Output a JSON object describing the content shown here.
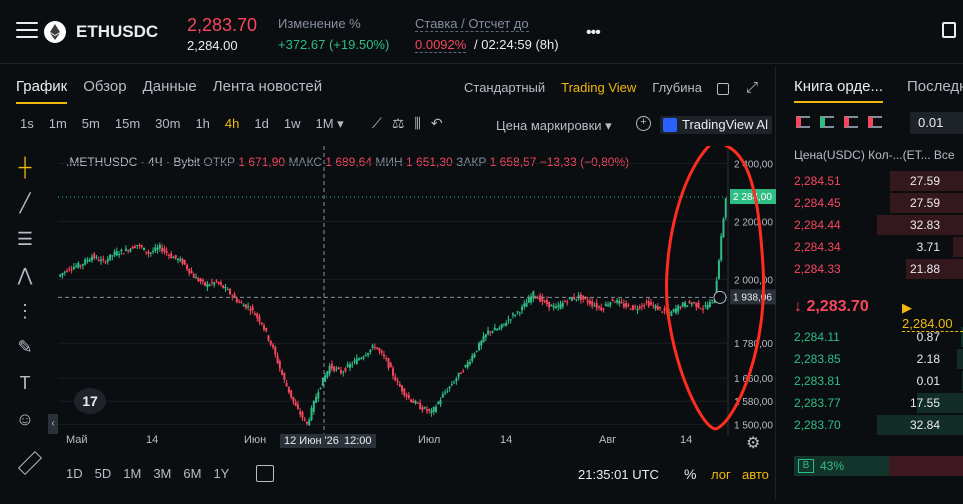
{
  "header": {
    "symbol": "ETHUSDC",
    "last_price": "2,283.70",
    "mark_price": "2,284.00",
    "change_label": "Изменение %",
    "change_value": "+372.67 (+19.50%)",
    "funding_label": "Ставка / Отсчет до",
    "funding_rate": "0.0092%",
    "funding_countdown": "/ 02:24:59 (8h)",
    "more_label": "•••"
  },
  "chart_panel": {
    "tabs": [
      "График",
      "Обзор",
      "Данные",
      "Лента новостей"
    ],
    "active_tab": 0,
    "views": [
      "Стандартный",
      "Trading View",
      "Глубина"
    ],
    "active_view": 1,
    "intervals": [
      "1s",
      "1m",
      "5m",
      "15m",
      "30m",
      "1h",
      "4h",
      "1d",
      "1w",
      "1M ▾"
    ],
    "active_interval": 6,
    "price_type": "Цена маркировки ▾",
    "tv_badge": "TradingView Al",
    "bottom_ranges": [
      "1D",
      "5D",
      "1M",
      "3M",
      "6M",
      "1Y"
    ],
    "clock": "21:35:01 UTC",
    "pct_label": "%",
    "log_label": "лог",
    "auto_label": "авто",
    "tv_logo": "17"
  },
  "ohlc": {
    "symbol_label": ".METHUSDC · 4Ч · Bybit",
    "open_label": "ОТКР",
    "open": "1 671,90",
    "high_label": "МАКС",
    "high": "1 689,64",
    "low_label": "МИН",
    "low": "1 651,30",
    "close_label": "ЗАКР",
    "close": "1 658,57",
    "change": "−13,33 (−0,80%)"
  },
  "chart_data": {
    "type": "candlestick",
    "x_ticks": [
      "Май",
      "14",
      "Июн",
      "12 Июн '26",
      "12:00",
      "Июл",
      "14",
      "Авг",
      "14"
    ],
    "y_ticks": [
      "2 400,00",
      "2 200,00",
      "2 000,00",
      "1 780,00",
      "1 660,00",
      "1 580,00",
      "1 500,00"
    ],
    "price_labels": {
      "last": "2 284,00",
      "crosshair": "1 938,06"
    },
    "ylim": [
      1460,
      2460
    ],
    "close_path": [
      2010,
      2040,
      2050,
      2080,
      2060,
      2090,
      2100,
      2120,
      2090,
      2110,
      2080,
      2060,
      2010,
      1980,
      1990,
      1960,
      1920,
      1900,
      1850,
      1760,
      1650,
      1560,
      1500,
      1620,
      1700,
      1680,
      1710,
      1740,
      1770,
      1720,
      1640,
      1590,
      1560,
      1540,
      1600,
      1650,
      1700,
      1760,
      1820,
      1830,
      1870,
      1900,
      1950,
      1920,
      1900,
      1930,
      1940,
      1920,
      1900,
      1930,
      1910,
      1900,
      1920,
      1900,
      1880,
      1910,
      1920,
      1900,
      1930,
      2284
    ],
    "annotation": "red hand-drawn circle around recent price spike"
  },
  "order_book": {
    "tabs": [
      "Книга орде...",
      "Последн"
    ],
    "precision": "0.01",
    "header": "Цена(USDC) Кол-...(ET... Все",
    "asks": [
      {
        "price": "2,284.51",
        "qty": "27.59",
        "depth": 0.66
      },
      {
        "price": "2,284.45",
        "qty": "27.59",
        "depth": 0.66
      },
      {
        "price": "2,284.44",
        "qty": "32.83",
        "depth": 0.78
      },
      {
        "price": "2,284.34",
        "qty": "3.71",
        "depth": 0.09
      },
      {
        "price": "2,284.33",
        "qty": "21.88",
        "depth": 0.52
      }
    ],
    "mid_price": "↓ 2,283.70",
    "mid_mark": "▶ 2,284.00",
    "bids": [
      {
        "price": "2,284.11",
        "qty": "0.87",
        "depth": 0.02
      },
      {
        "price": "2,283.85",
        "qty": "2.18",
        "depth": 0.05
      },
      {
        "price": "2,283.81",
        "qty": "0.01",
        "depth": 0.01
      },
      {
        "price": "2,283.77",
        "qty": "17.55",
        "depth": 0.42
      },
      {
        "price": "2,283.70",
        "qty": "32.84",
        "depth": 0.78
      }
    ],
    "buy_badge": "B",
    "buy_pct": "43%"
  },
  "colors": {
    "up": "#2ebd85",
    "down": "#f6465d",
    "accent": "#f0b90b",
    "annotation": "#ff2d1f"
  }
}
